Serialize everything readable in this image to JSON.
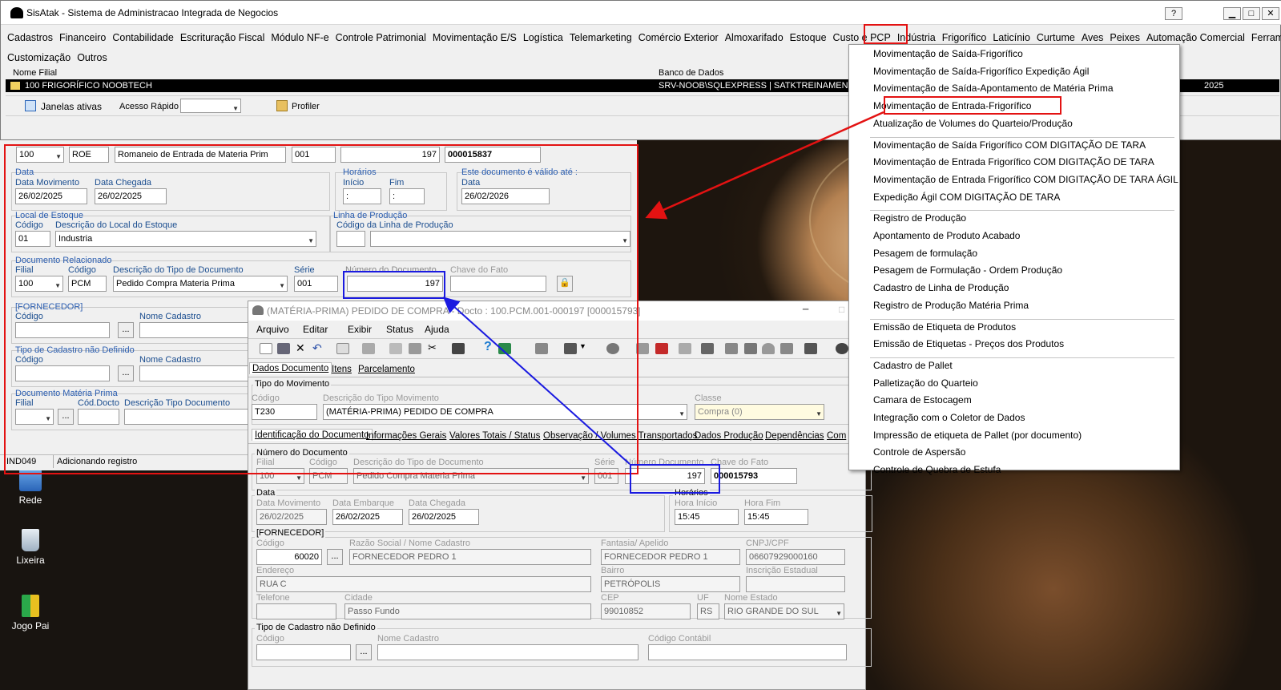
{
  "app": {
    "title": "SisAtak - Sistema de Administracao Integrada de Negocios",
    "help": "?",
    "min": "▁",
    "max": "□",
    "close": "✕"
  },
  "menu": [
    "Cadastros",
    "Financeiro",
    "Contabilidade",
    "Escrituração Fiscal",
    "Módulo NF-e",
    "Controle Patrimonial",
    "Movimentação E/S",
    "Logística",
    "Telemarketing",
    "Comércio Exterior",
    "Almoxarifado",
    "Estoque",
    "Custo e PCP",
    "Indústria",
    "Frigorífico",
    "Laticínio",
    "Curtume",
    "Aves",
    "Peixes",
    "Automação Comercial",
    "Ferramentas"
  ],
  "menu2": [
    "Customização",
    "Outros"
  ],
  "header": {
    "filial_label": "Nome Filial",
    "db_label": "Banco de Dados",
    "filial": "100 FRIGORÍFICO NOOBTECH",
    "db": "SRV-NOOB\\SQLEXPRESS | SATKTREINAMENTO",
    "year": "2025"
  },
  "toolbar": {
    "janelas": "Janelas ativas",
    "acesso": "Acesso Rápido",
    "profiler": "Profiler"
  },
  "dropdown": {
    "groups": [
      [
        "Movimentação de Saída-Frigorífico",
        "Movimentação de Saída-Frigorífico Expedição Ágil",
        "Movimentação de Saída-Apontamento de Matéria Prima",
        "Movimentação de Entrada-Frigorífico",
        "Atualização de Volumes do Quarteio/Produção"
      ],
      [
        "Movimentação de Saída Frigorífico COM DIGITAÇÃO DE TARA",
        "Movimentação de Entrada Frigorífico COM DIGITAÇÃO DE TARA",
        "Movimentação de Entrada Frigorífico COM DIGITAÇÃO DE TARA ÁGIL",
        "Expedição Ágil COM DIGITAÇÃO DE TARA"
      ],
      [
        "Registro de Produção",
        "Apontamento de Produto Acabado",
        "Pesagem de formulação",
        "Pesagem de Formulação - Ordem Produção",
        "Cadastro de Linha de Produção",
        "Registro de Produção Matéria Prima"
      ],
      [
        "Emissão de Etiqueta de Produtos",
        "Emissão de Etiquetas - Preços dos Produtos"
      ],
      [
        "Cadastro de Pallet",
        "Palletização do Quarteio",
        "Camara de Estocagem",
        "Integração com o Coletor de Dados",
        "Impressão de etiqueta de Pallet (por documento)",
        "Controle de Aspersão",
        "Controle de Quebra de Estufa"
      ]
    ]
  },
  "romaneio": {
    "filial": "100",
    "origem": "ROE",
    "desc": "Romaneio de Entrada de Materia Prim",
    "serie": "001",
    "numero": "197",
    "chave": "000015837",
    "data_group": "Data",
    "data_mov_l": "Data Movimento",
    "data_mov": "26/02/2025",
    "data_che_l": "Data Chegada",
    "data_che": "26/02/2025",
    "hor_group": "Horários",
    "inicio_l": "Início",
    "fim_l": "Fim",
    "inicio": ":",
    "fim": ":",
    "valid_group": "Este documento é válido até :",
    "valid_data_l": "Data",
    "valid_data": "26/02/2026",
    "local_group": "Local de Estoque",
    "cod_l": "Código",
    "desc_local_l": "Descrição do Local do Estoque",
    "local_cod": "01",
    "local_desc": "Industria",
    "linha_group": "Linha de Produção",
    "linha_cod_l": "Código da Linha de Produção",
    "docrel_group": "Documento Relacionado",
    "filial_l": "Filial",
    "codigo_l": "Código",
    "tipo_l": "Descrição do Tipo de Documento",
    "serie_l": "Série",
    "numdoc_l": "Número do Documento",
    "chavefato_l": "Chave do Fato",
    "dr_filial": "100",
    "dr_cod": "PCM",
    "dr_desc": "Pedido Compra Materia Prima",
    "dr_serie": "001",
    "dr_num": "197",
    "forn_group": "[FORNECEDOR]",
    "nome_cad_l": "Nome Cadastro",
    "tipo_cad_group": "Tipo de Cadastro não Definido",
    "docmp_group": "Documento Matéria Prima",
    "coddocto_l": "Cód.Docto",
    "desctipo_l": "Descrição Tipo Documento",
    "dots": "...",
    "status1": "IND049",
    "status2": "Adicionando registro"
  },
  "desktop": {
    "rede": "Rede",
    "lixeira": "Lixeira",
    "jogo": "Jogo Pai"
  },
  "pedido": {
    "title": "(MATÉRIA-PRIMA) PEDIDO DE COMPRA - Docto : 100.PCM.001-000197 [000015793]",
    "menu": [
      "Arquivo",
      "Editar",
      "Exibir",
      "Status",
      "Ajuda"
    ],
    "tabs": [
      "Dados Documento",
      "Itens",
      "Parcelamento"
    ],
    "tipo_group": "Tipo do Movimento",
    "codigo_l": "Código",
    "desc_tm_l": "Descrição do Tipo Movimento",
    "classe_l": "Classe",
    "tm_cod": "T230",
    "tm_desc": "(MATÉRIA-PRIMA) PEDIDO DE COMPRA",
    "classe": "Compra (0)",
    "subtabs": [
      "Identificação do Documento",
      "Informações Gerais",
      "Valores Totais / Status",
      "Observação / Volumes Transportados",
      "Dados Produção",
      "Dependências",
      "Com"
    ],
    "num_group": "Número do Documento",
    "filial_l": "Filial",
    "cod_l": "Código",
    "tipo_l": "Descrição do Tipo de Documento",
    "serie_l": "Série",
    "numdoc_l": "Número Documento",
    "chave_l": "Chave do Fato",
    "filial": "100",
    "cod": "PCM",
    "tipo": "Pedido Compra Materia Prima",
    "serie": "001",
    "numdoc": "197",
    "chave": "000015793",
    "data_group": "Data",
    "dmov_l": "Data Movimento",
    "demb_l": "Data Embarque",
    "dche_l": "Data Chegada",
    "dmov": "26/02/2025",
    "demb": "26/02/2025",
    "dche": "26/02/2025",
    "hor_group": "Horários",
    "hini_l": "Hora Início",
    "hfim_l": "Hora Fim",
    "hini": "15:45",
    "hfim": "15:45",
    "forn_group": "[FORNECEDOR]",
    "forn_cod_l": "Código",
    "razao_l": "Razão Social / Nome Cadastro",
    "fant_l": "Fantasia/ Apelido",
    "cnpj_l": "CNPJ/CPF",
    "forn_cod": "60020",
    "razao": "FORNECEDOR PEDRO 1",
    "fant": "FORNECEDOR PEDRO 1",
    "cnpj": "06607929000160",
    "end_l": "Endereço",
    "bairro_l": "Bairro",
    "ie_l": "Inscrição Estadual",
    "end": "RUA C",
    "bairro": "PETRÓPOLIS",
    "tel_l": "Telefone",
    "cidade_l": "Cidade",
    "cep_l": "CEP",
    "uf_l": "UF",
    "nome_est_l": "Nome Estado",
    "cidade": "Passo Fundo",
    "cep": "99010852",
    "uf": "RS",
    "estado": "RIO GRANDE DO SUL",
    "tcnd_group": "Tipo de Cadastro não Definido",
    "tc_cod_l": "Código",
    "tc_nome_l": "Nome Cadastro",
    "tc_contabil_l": "Código Contábil",
    "dots": "..."
  }
}
